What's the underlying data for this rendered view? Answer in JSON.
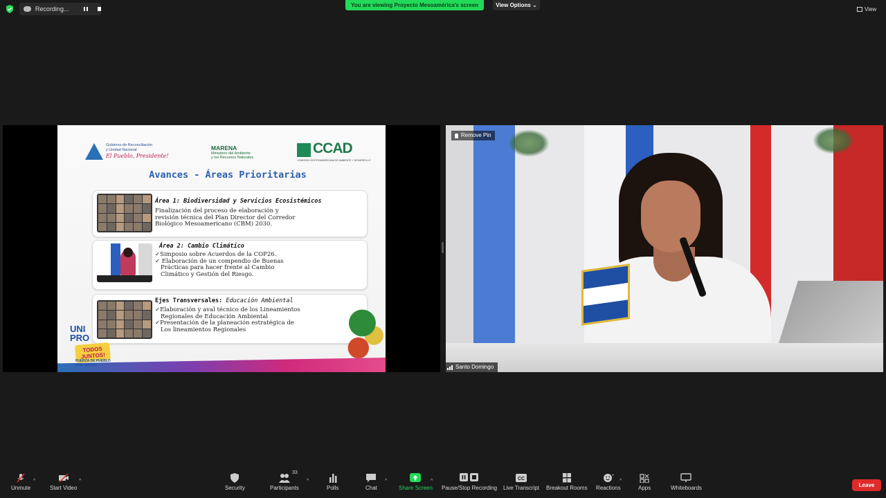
{
  "topbar": {
    "recording_label": "Recording...",
    "viewing_banner": "You are viewing Proyecto Mesoamérica's screen",
    "view_options": "View Options",
    "view_label": "View"
  },
  "slide": {
    "gov_line1": "Gobierno de Reconciliación",
    "gov_line2": "y Unidad Nacional",
    "gov_slogan": "El Pueblo, Presidente!",
    "marena_title": "MARENA",
    "marena_line1": "Ministerio del Ambiente",
    "marena_line2": "y los Recursos Naturales",
    "ccad": "CCAD",
    "ccad_sub": "COMISIÓN CENTROAMERICANA DE AMBIENTE Y DESARROLLO",
    "title": "Avances - Áreas Prioritarias",
    "card1": {
      "head": "Área 1: Biodiversidad y Servicios Ecosistémicos",
      "lines": [
        "Finalización del proceso de elaboración y",
        "revisión técnica del Plan Director del Corredor",
        "Biológico Mesoamericano (CBM) 2030."
      ]
    },
    "card2": {
      "head": "Área 2: Cambio Climático",
      "lines": [
        "Simposio sobre Acuerdos de la COP26.",
        " Elaboración de un compendio de Buenas",
        "Prácticas para hacer frente al Cambio",
        "Climático y Gestión del Riesgo."
      ]
    },
    "card3": {
      "head_bold": "Ejes Transversales:",
      "head_italic": "Educación Ambiental",
      "lines": [
        "Elaboración y aval técnico de los Lineamientos",
        "Regionales de Educación Ambiental",
        "Presentación de la planeación estratégica de",
        "Los lineamientos Regionales"
      ]
    },
    "unidad_1": "UNI",
    "unidad_2": "PRO",
    "todos": "TODOS JUNTOS!",
    "fuerza": "FUERZA DE PUEBLO QUE VENCE!"
  },
  "camera": {
    "remove_pin": "Remove Pin",
    "name": "Santo Domingo"
  },
  "toolbar": {
    "unmute": "Unmute",
    "start_video": "Start Video",
    "security": "Security",
    "participants": "Participants",
    "participants_count": "33",
    "polls": "Polls",
    "chat": "Chat",
    "share_screen": "Share Screen",
    "pause_stop": "Pause/Stop Recording",
    "live_transcript": "Live Transcript",
    "breakout": "Breakout Rooms",
    "reactions": "Reactions",
    "apps": "Apps",
    "whiteboards": "Whiteboards",
    "leave": "Leave"
  },
  "colors": {
    "banner_green": "#23d959",
    "share_green": "#23d959",
    "leave_red": "#e02b2b",
    "slide_title_blue": "#2b5fb0"
  }
}
